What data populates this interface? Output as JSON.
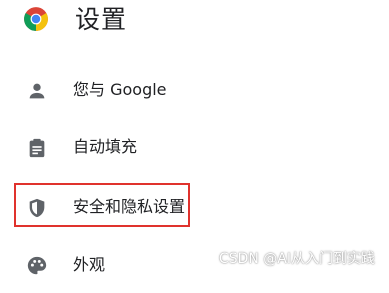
{
  "header": {
    "title": "设置",
    "logo_icon": "chrome-logo"
  },
  "menu": {
    "items": [
      {
        "label": "您与 Google",
        "icon": "person-icon"
      },
      {
        "label": "自动填充",
        "icon": "clipboard-icon"
      },
      {
        "label": "安全和隐私设置",
        "icon": "shield-icon",
        "highlighted": true
      },
      {
        "label": "外观",
        "icon": "palette-icon"
      }
    ]
  },
  "colors": {
    "icon": "#5f6368",
    "text": "#202124",
    "highlight_border": "#e0322d"
  },
  "watermark": {
    "text": "CSDN @AI从入门到实践"
  }
}
